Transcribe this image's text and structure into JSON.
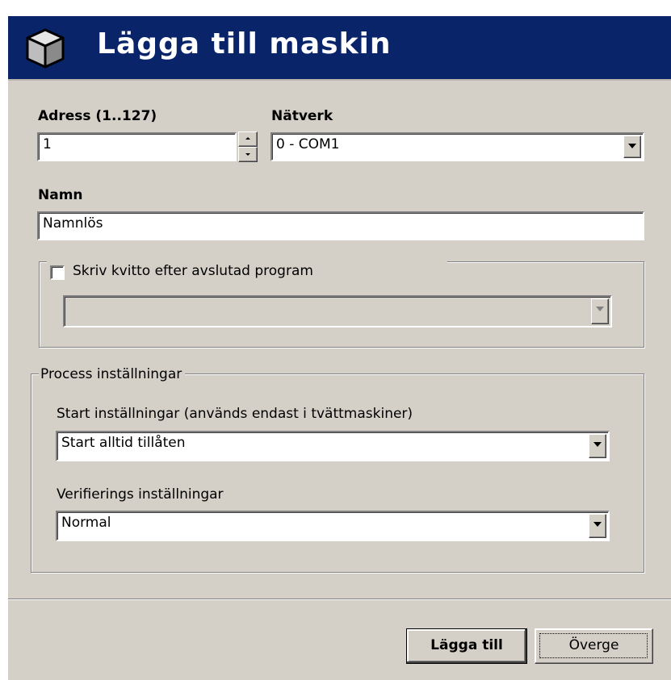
{
  "dialog": {
    "title": "Lägga till maskin",
    "icon": "cube-icon"
  },
  "address": {
    "label": "Adress (1..127)",
    "value": "1"
  },
  "network": {
    "label": "Nätverk",
    "selected": "0 - COM1"
  },
  "name": {
    "label": "Namn",
    "value": "Namnlös"
  },
  "receipt": {
    "checkbox_label": "Skriv kvitto efter avslutad program",
    "checked": false,
    "selected": ""
  },
  "process": {
    "group_label": "Process inställningar",
    "start": {
      "label": "Start inställningar (används endast i tvättmaskiner)",
      "selected": "Start alltid tillåten"
    },
    "verification": {
      "label": "Verifierings inställningar",
      "selected": "Normal"
    }
  },
  "buttons": {
    "add": "Lägga till",
    "cancel": "Överge"
  },
  "colors": {
    "title_bar": "#0a246a",
    "dialog_bg": "#d4d0c8"
  }
}
